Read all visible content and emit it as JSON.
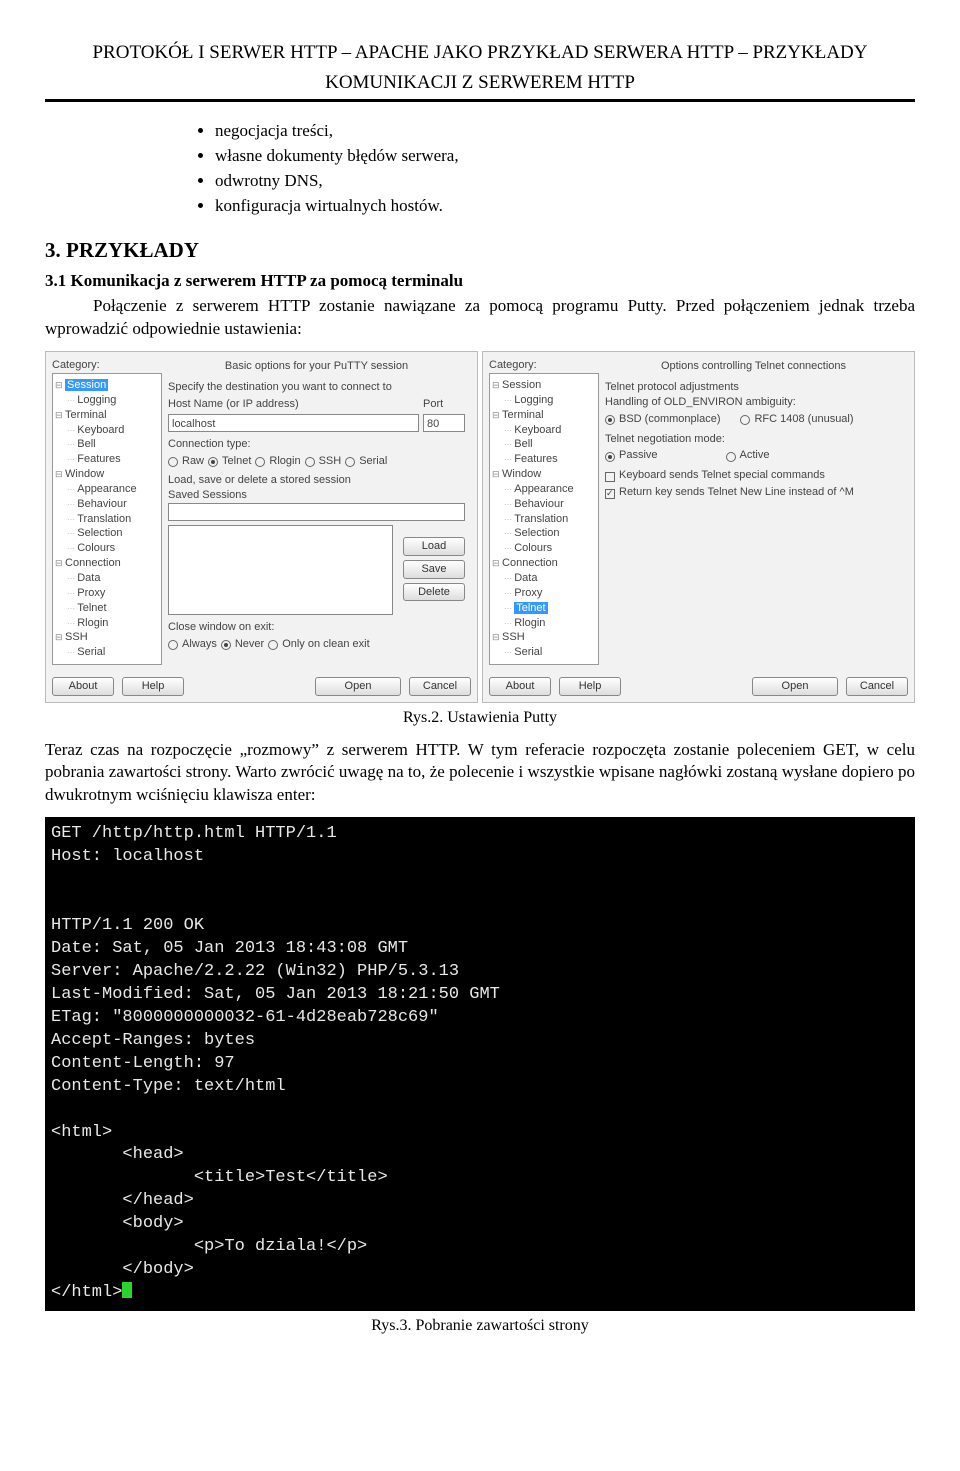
{
  "header": {
    "line1": "PROTOKÓŁ I SERWER HTTP – APACHE JAKO PRZYKŁAD SERWERA HTTP – PRZYKŁADY",
    "line2": "KOMUNIKACJI Z SERWEREM HTTP"
  },
  "bullets": [
    "negocjacja treści,",
    "własne dokumenty błędów serwera,",
    "odwrotny DNS,",
    "konfiguracja wirtualnych hostów."
  ],
  "section3": {
    "title": "3. PRZYKŁADY"
  },
  "sub31": {
    "title": "3.1 Komunikacja z serwerem HTTP za pomocą terminalu",
    "para": "Połączenie z serwerem HTTP zostanie nawiązane za pomocą programu Putty. Przed połączeniem jednak trzeba wprowadzić odpowiednie ustawienia:"
  },
  "putty": {
    "left": {
      "cat_label": "Category:",
      "tree": {
        "session": "Session",
        "logging": "Logging",
        "terminal": "Terminal",
        "keyboard": "Keyboard",
        "bell": "Bell",
        "features": "Features",
        "window": "Window",
        "appearance": "Appearance",
        "behaviour": "Behaviour",
        "translation": "Translation",
        "selection": "Selection",
        "colours": "Colours",
        "connection": "Connection",
        "data": "Data",
        "proxy": "Proxy",
        "telnet": "Telnet",
        "rlogin": "Rlogin",
        "ssh": "SSH",
        "serial": "Serial"
      },
      "banner": "Basic options for your PuTTY session",
      "hostline": "Specify the destination you want to connect to",
      "host_label": "Host Name (or IP address)",
      "port_label": "Port",
      "host_value": "localhost",
      "port_value": "80",
      "conn_type_label": "Connection type:",
      "raw": "Raw",
      "telnet_r": "Telnet",
      "rlogin_r": "Rlogin",
      "ssh_r": "SSH",
      "serial_r": "Serial",
      "lss_label": "Load, save or delete a stored session",
      "saved_sessions": "Saved Sessions",
      "btn_load": "Load",
      "btn_save": "Save",
      "btn_delete": "Delete",
      "close_label": "Close window on exit:",
      "always": "Always",
      "never": "Never",
      "clean": "Only on clean exit",
      "btn_about": "About",
      "btn_help": "Help",
      "btn_open": "Open",
      "btn_cancel": "Cancel"
    },
    "right": {
      "cat_label": "Category:",
      "banner": "Options controlling Telnet connections",
      "proto_label": "Telnet protocol adjustments",
      "old_env_label": "Handling of OLD_ENVIRON ambiguity:",
      "bsd": "BSD (commonplace)",
      "rfc": "RFC 1408 (unusual)",
      "negot_label": "Telnet negotiation mode:",
      "passive": "Passive",
      "active": "Active",
      "chk1": "Keyboard sends Telnet special commands",
      "chk2": "Return key sends Telnet New Line instead of ^M",
      "btn_about": "About",
      "btn_help": "Help",
      "btn_open": "Open",
      "btn_cancel": "Cancel"
    }
  },
  "caption2": "Rys.2. Ustawienia Putty",
  "para2": "Teraz czas na rozpoczęcie „rozmowy” z serwerem HTTP. W tym referacie rozpoczęta zostanie poleceniem GET, w celu pobrania zawartości strony. Warto zwrócić uwagę na to, że polecenie i wszystkie wpisane nagłówki zostaną wysłane dopiero po dwukrotnym wciśnięciu klawisza enter:",
  "terminal": {
    "lines": [
      "GET /http/http.html HTTP/1.1",
      "Host: localhost",
      "",
      "",
      "HTTP/1.1 200 OK",
      "Date: Sat, 05 Jan 2013 18:43:08 GMT",
      "Server: Apache/2.2.22 (Win32) PHP/5.3.13",
      "Last-Modified: Sat, 05 Jan 2013 18:21:50 GMT",
      "ETag: \"8000000000032-61-4d28eab728c69\"",
      "Accept-Ranges: bytes",
      "Content-Length: 97",
      "Content-Type: text/html",
      "",
      "<html>",
      "       <head>",
      "              <title>Test</title>",
      "       </head>",
      "       <body>",
      "              <p>To dziala!</p>",
      "       </body>",
      "</html>"
    ]
  },
  "caption3": "Rys.3. Pobranie zawartości strony"
}
